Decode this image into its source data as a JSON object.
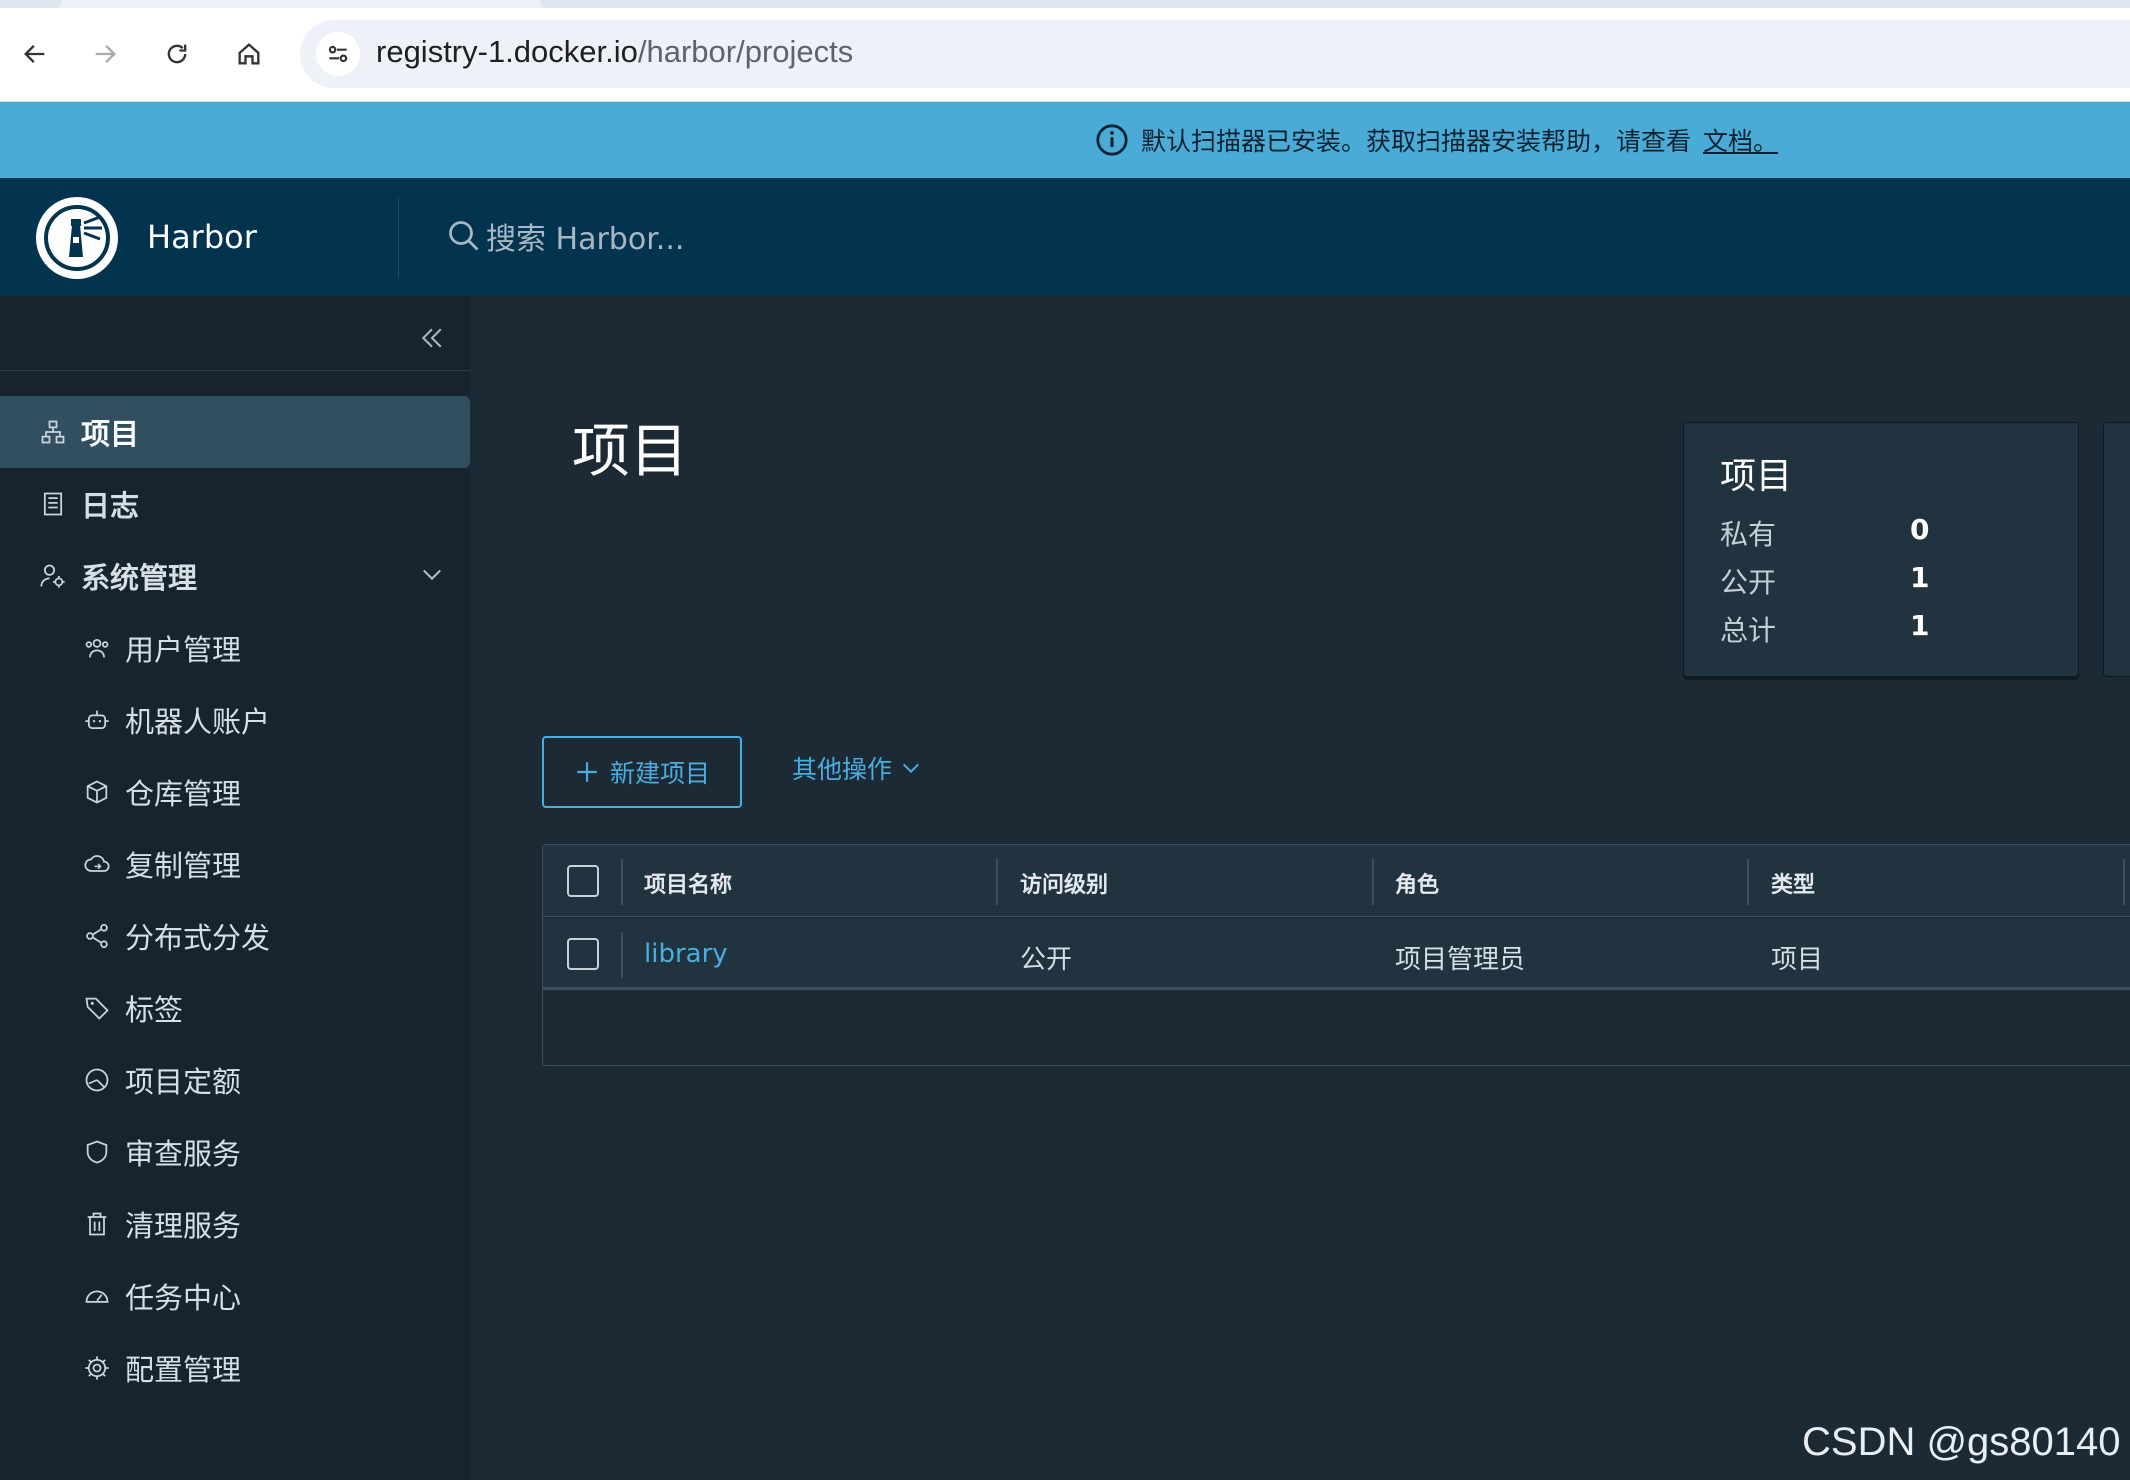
{
  "browser": {
    "url_host": "registry-1.docker.io",
    "url_path": "/harbor/projects"
  },
  "banner": {
    "message": "默认扫描器已安装。获取扫描器安装帮助，请查看",
    "link": "文档。"
  },
  "header": {
    "brand": "Harbor",
    "search_placeholder": "搜索 Harbor..."
  },
  "sidebar": {
    "items": [
      {
        "label": "项目",
        "icon": "projects-icon"
      },
      {
        "label": "日志",
        "icon": "logs-icon"
      },
      {
        "label": "系统管理",
        "icon": "admin-icon"
      }
    ],
    "sub_items": [
      {
        "label": "用户管理",
        "icon": "users-icon"
      },
      {
        "label": "机器人账户",
        "icon": "robot-icon"
      },
      {
        "label": "仓库管理",
        "icon": "registry-icon"
      },
      {
        "label": "复制管理",
        "icon": "replication-icon"
      },
      {
        "label": "分布式分发",
        "icon": "distribution-icon"
      },
      {
        "label": "标签",
        "icon": "tag-icon"
      },
      {
        "label": "项目定额",
        "icon": "quota-icon"
      },
      {
        "label": "审查服务",
        "icon": "shield-icon"
      },
      {
        "label": "清理服务",
        "icon": "trash-icon"
      },
      {
        "label": "任务中心",
        "icon": "dashboard-icon"
      },
      {
        "label": "配置管理",
        "icon": "gear-icon"
      }
    ]
  },
  "main": {
    "title": "项目",
    "summary": {
      "title": "项目",
      "rows": [
        {
          "label": "私有",
          "value": "0"
        },
        {
          "label": "公开",
          "value": "1"
        },
        {
          "label": "总计",
          "value": "1"
        }
      ]
    },
    "new_project_label": "新建项目",
    "more_actions_label": "其他操作",
    "table": {
      "columns": [
        "项目名称",
        "访问级别",
        "角色",
        "类型"
      ],
      "rows": [
        [
          "library",
          "公开",
          "项目管理员",
          "项目"
        ]
      ]
    }
  },
  "watermark": "CSDN @gs80140"
}
